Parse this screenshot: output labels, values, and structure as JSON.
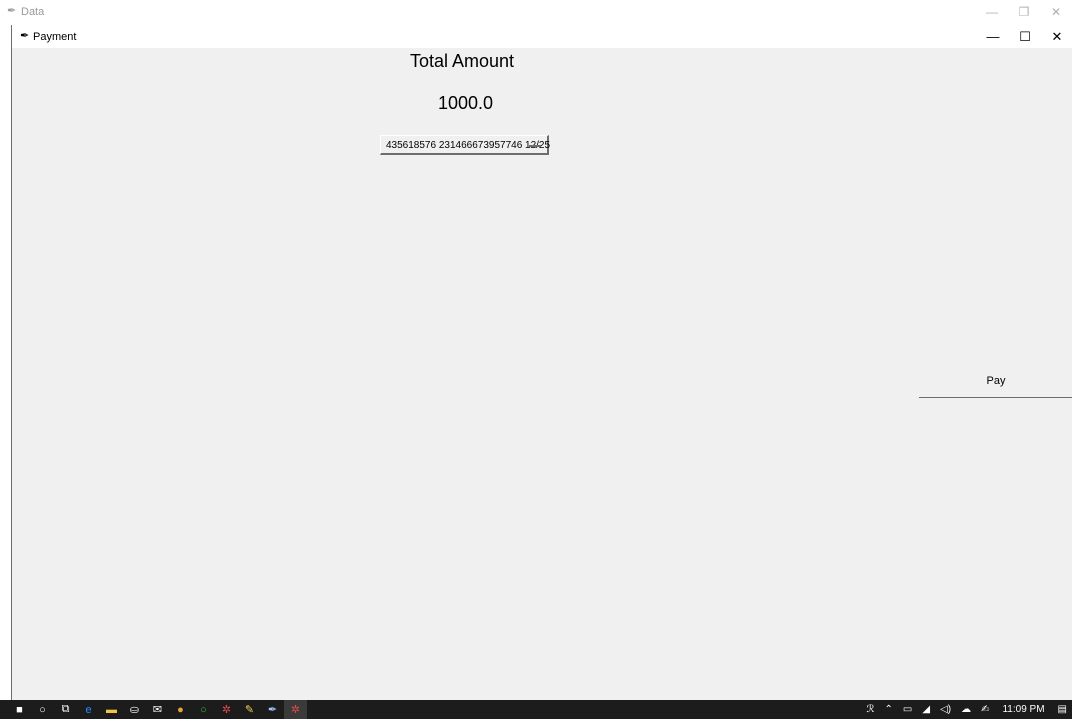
{
  "back_window": {
    "title": "Data",
    "controls": {
      "minimize": "—",
      "restore": "❐",
      "close": "✕"
    }
  },
  "window": {
    "title": "Payment",
    "controls": {
      "minimize": "—",
      "maximize": "☐",
      "close": "✕"
    }
  },
  "content": {
    "total_label": "Total Amount",
    "amount": "1000.0",
    "card_select_value": "435618576 231466673957746 12/25",
    "pay_label": "Pay"
  },
  "taskbar": {
    "apps": [
      {
        "icon": "windows-start-icon",
        "glyph": "■",
        "color": "#ffffff"
      },
      {
        "icon": "search-icon",
        "glyph": "○",
        "color": "#ffffff"
      },
      {
        "icon": "task-view-icon",
        "glyph": "⧉",
        "color": "#ffffff"
      },
      {
        "icon": "edge-icon",
        "glyph": "e",
        "color": "#1e90ff"
      },
      {
        "icon": "file-explorer-icon",
        "glyph": "▬",
        "color": "#f4c542"
      },
      {
        "icon": "store-icon",
        "glyph": "⛀",
        "color": "#ffffff"
      },
      {
        "icon": "mail-icon",
        "glyph": "✉",
        "color": "#ffffff"
      },
      {
        "icon": "chrome-icon",
        "glyph": "●",
        "color": "#e8a33a"
      },
      {
        "icon": "app-circle-icon",
        "glyph": "○",
        "color": "#36c236"
      },
      {
        "icon": "python-feather-icon",
        "glyph": "✲",
        "color": "#e04a4a"
      },
      {
        "icon": "paint-icon",
        "glyph": "✎",
        "color": "#f2d44a"
      },
      {
        "icon": "feather-icon",
        "glyph": "✒",
        "color": "#9ecbff"
      },
      {
        "icon": "python-feather-active-icon",
        "glyph": "✲",
        "color": "#e04a4a"
      }
    ],
    "tray": {
      "people": "ℛ",
      "chevron": "⌃",
      "battery": "▭",
      "wifi": "◢",
      "volume": "◁)",
      "cloud": "☁",
      "pen": "✍",
      "time": "11:09 PM",
      "notification": "▤"
    }
  }
}
